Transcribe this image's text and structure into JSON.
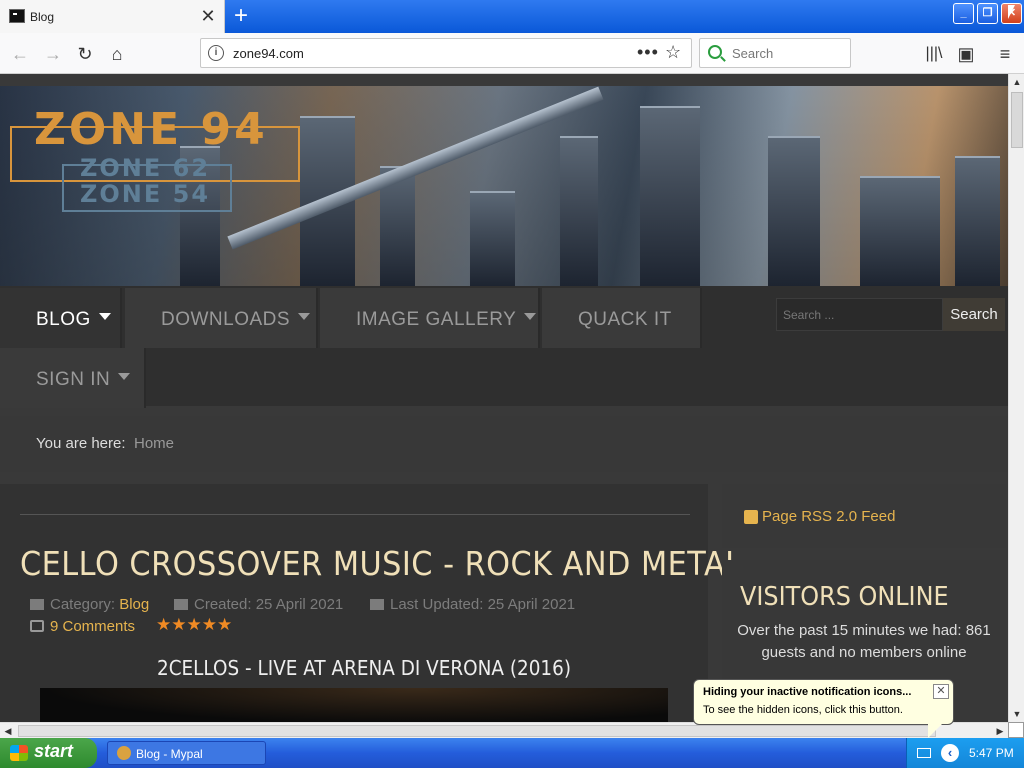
{
  "browser": {
    "tab_title": "Blog",
    "tab_close": "✕",
    "new_tab": "+",
    "url": "zone94.com",
    "url_menu": "•••",
    "bookmark_star": "☆",
    "search_placeholder": "Search",
    "nav_icons": [
      "arrow-back-icon",
      "arrow-forward-icon",
      "reload-icon",
      "home-icon"
    ],
    "toolbar_icons": [
      "library-icon",
      "sidebar-icon",
      "menu-icon"
    ]
  },
  "site": {
    "logo": {
      "main": "ZONE 94",
      "line2": "ZONE 62",
      "line3": "ZONE 54"
    },
    "nav": [
      {
        "label": "BLOG",
        "caret": true,
        "active": true
      },
      {
        "label": "DOWNLOADS",
        "caret": true
      },
      {
        "label": "IMAGE GALLERY",
        "caret": true
      },
      {
        "label": "QUACK IT",
        "caret": false
      },
      {
        "label": "SIGN IN",
        "caret": true
      }
    ],
    "search_placeholder": "Search ...",
    "search_button": "Search",
    "breadcrumb": {
      "label": "You are here:",
      "home": "Home"
    }
  },
  "article": {
    "title": "CELLO CROSSOVER MUSIC - ROCK AND METAL",
    "category_label": "Category:",
    "category": "Blog",
    "created": "Created: 25 April 2021",
    "updated": "Last Updated: 25 April 2021",
    "comments": "9 Comments",
    "rating": "★★★★★",
    "rating_value": 5,
    "video_title": "2CELLOS - LIVE AT ARENA DI VERONA (2016)"
  },
  "sidebar": {
    "rss": "Page RSS 2.0 Feed",
    "visitors_title": "VISITORS ONLINE",
    "visitors_text": "Over the past 15 minutes we had: 861 guests and no members online"
  },
  "taskbar": {
    "start": "start",
    "task": "Blog - Mypal",
    "clock": "5:47 PM"
  },
  "balloon": {
    "title": "Hiding your inactive notification icons...",
    "body": "To see the hidden icons, click this button.",
    "close": "✕"
  }
}
